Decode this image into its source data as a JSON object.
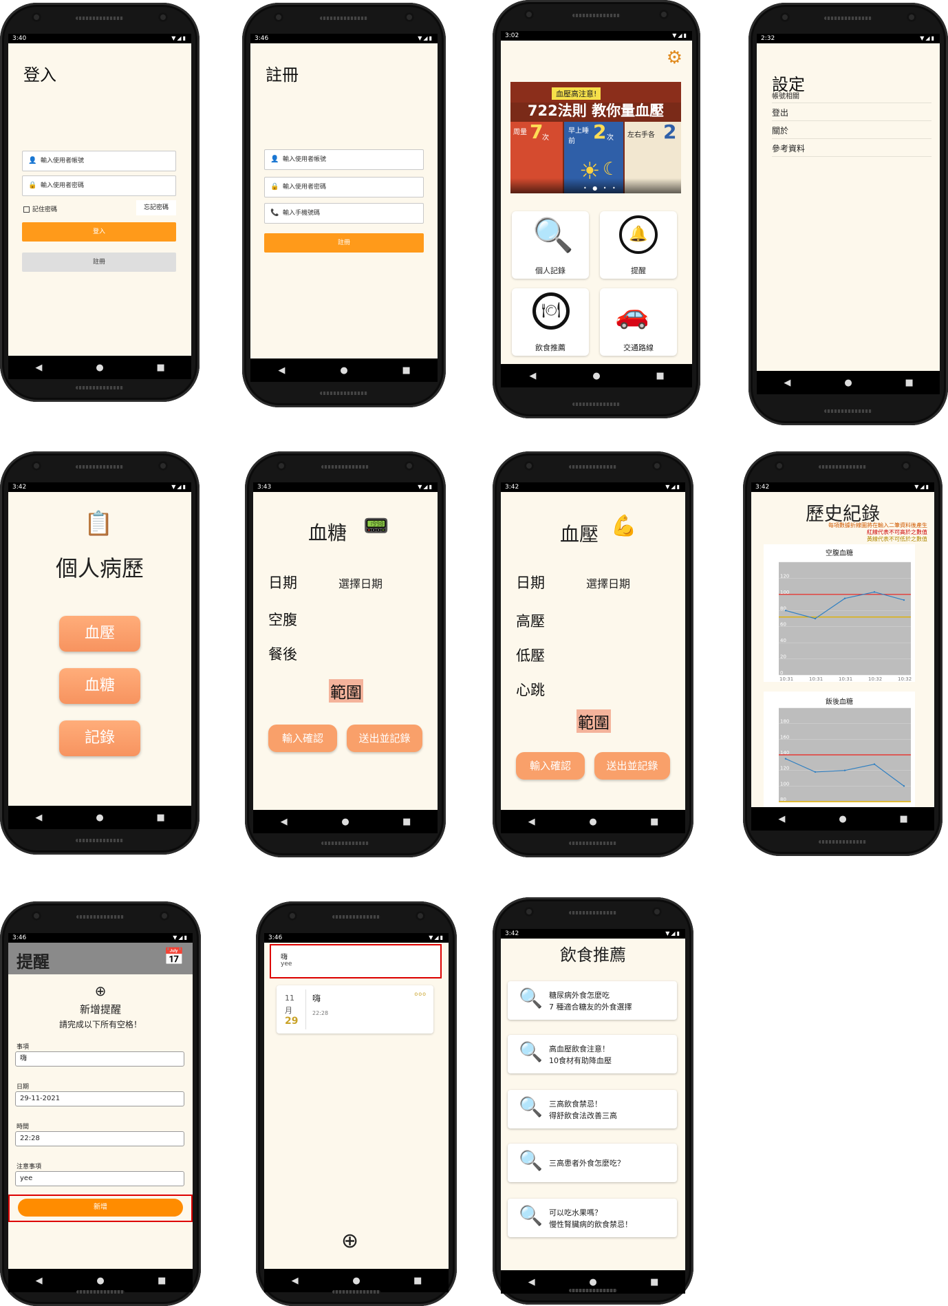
{
  "login": {
    "time": "3:40",
    "title": "登入",
    "user_placeholder": "輸入使用者帳號",
    "pass_placeholder": "輸入使用者密碼",
    "remember": "記住密碼",
    "forgot": "忘記密碼",
    "login_btn": "登入",
    "register_btn": "註冊"
  },
  "register": {
    "time": "3:46",
    "title": "註冊",
    "user_placeholder": "輸入使用者帳號",
    "pass_placeholder": "輸入使用者密碼",
    "phone_placeholder": "輸入手機號碼",
    "register_btn": "註冊"
  },
  "home": {
    "time": "3:02",
    "banner": {
      "line1": "血壓高注意!",
      "line2": "722法則 教你量血壓",
      "n1": "7",
      "n2": "2",
      "n3": "2",
      "t1": "周量",
      "t2": "早上睡前",
      "t3": "左右手各",
      "u1": "次",
      "u2": "次"
    },
    "items": [
      "個人記錄",
      "提醒",
      "飲食推薦",
      "交通路線"
    ]
  },
  "settings": {
    "time": "2:32",
    "title": "設定",
    "items": [
      "帳號相關",
      "登出",
      "關於",
      "參考資料"
    ]
  },
  "history_menu": {
    "time": "3:42",
    "title": "個人病歷",
    "buttons": [
      "血壓",
      "血糖",
      "記錄"
    ]
  },
  "sugar": {
    "time": "3:43",
    "title": "血糖",
    "date_label": "日期",
    "date_value": "選擇日期",
    "fasting": "空腹",
    "after_meal": "餐後",
    "range": "範圍",
    "confirm": "輸入確認",
    "submit": "送出並記錄"
  },
  "pressure": {
    "time": "3:42",
    "title": "血壓",
    "date_label": "日期",
    "date_value": "選擇日期",
    "high": "高壓",
    "low": "低壓",
    "pulse": "心跳",
    "range": "範圍",
    "confirm": "輸入確認",
    "submit": "送出並記錄"
  },
  "records": {
    "time": "3:42",
    "title": "歷史紀錄",
    "note": [
      "每項數據折線圖將在輸入二筆資料後產生",
      "紅線代表不可高於之數值",
      "黃線代表不可低於之數值"
    ]
  },
  "chart_data": [
    {
      "type": "line",
      "title": "空腹血糖",
      "ylim": [
        0,
        140
      ],
      "yticks": [
        "140",
        "120",
        "100",
        "80",
        "60",
        "40",
        "20",
        "0"
      ],
      "categories": [
        "10:31",
        "10:31",
        "10:31",
        "10:32",
        "10:32"
      ],
      "series": [
        {
          "values": [
            80,
            70,
            95,
            103,
            93
          ]
        }
      ],
      "red_limit": 100,
      "yellow_limit": 72
    },
    {
      "type": "line",
      "title": "飯後血糖",
      "ylim": [
        80,
        200
      ],
      "yticks": [
        "200",
        "180",
        "160",
        "140",
        "120",
        "100",
        "80"
      ],
      "categories": [],
      "series": [
        {
          "values": [
            135,
            118,
            120,
            128,
            100
          ]
        }
      ],
      "red_limit": 140,
      "yellow_limit": 80
    }
  ],
  "reminder": {
    "time": "3:46",
    "title": "提醒",
    "add_title": "新增提醒",
    "instruction": "請完成以下所有空格！",
    "item_label": "事項",
    "item_value": "嗨",
    "date_label": "日期",
    "date_value": "29-11-2021",
    "time_label": "時間",
    "time_value": "22:28",
    "note_label": "注意事項",
    "note_value": "yee",
    "add_btn": "新增"
  },
  "reminder_list": {
    "time": "3:46",
    "top_title": "嗨",
    "top_sub": "yee",
    "card_month_num": "11",
    "card_month": "月",
    "card_day": "29",
    "card_title": "嗨",
    "card_time": "22:28",
    "card_dots": "ooo"
  },
  "diet": {
    "time": "3:42",
    "title": "飲食推薦",
    "items": [
      [
        "糖尿病外食怎麼吃",
        "7 種適合糖友的外食選擇"
      ],
      [
        "高血壓飲食注意！",
        "10食材有助降血壓"
      ],
      [
        "三高飲食禁忌！",
        "得舒飲食法改善三高"
      ],
      [
        "三高患者外食怎麼吃？",
        ""
      ],
      [
        "可以吃水果嗎？",
        "慢性腎臟病的飲食禁忌！"
      ]
    ]
  },
  "colors": {
    "orange": "#ff9a1a",
    "peach": "#f9a06a",
    "bg": "#fdf8ec",
    "red_line": "#e53935",
    "yellow_line": "#e0b000",
    "blue_line": "#2f7fc1"
  }
}
